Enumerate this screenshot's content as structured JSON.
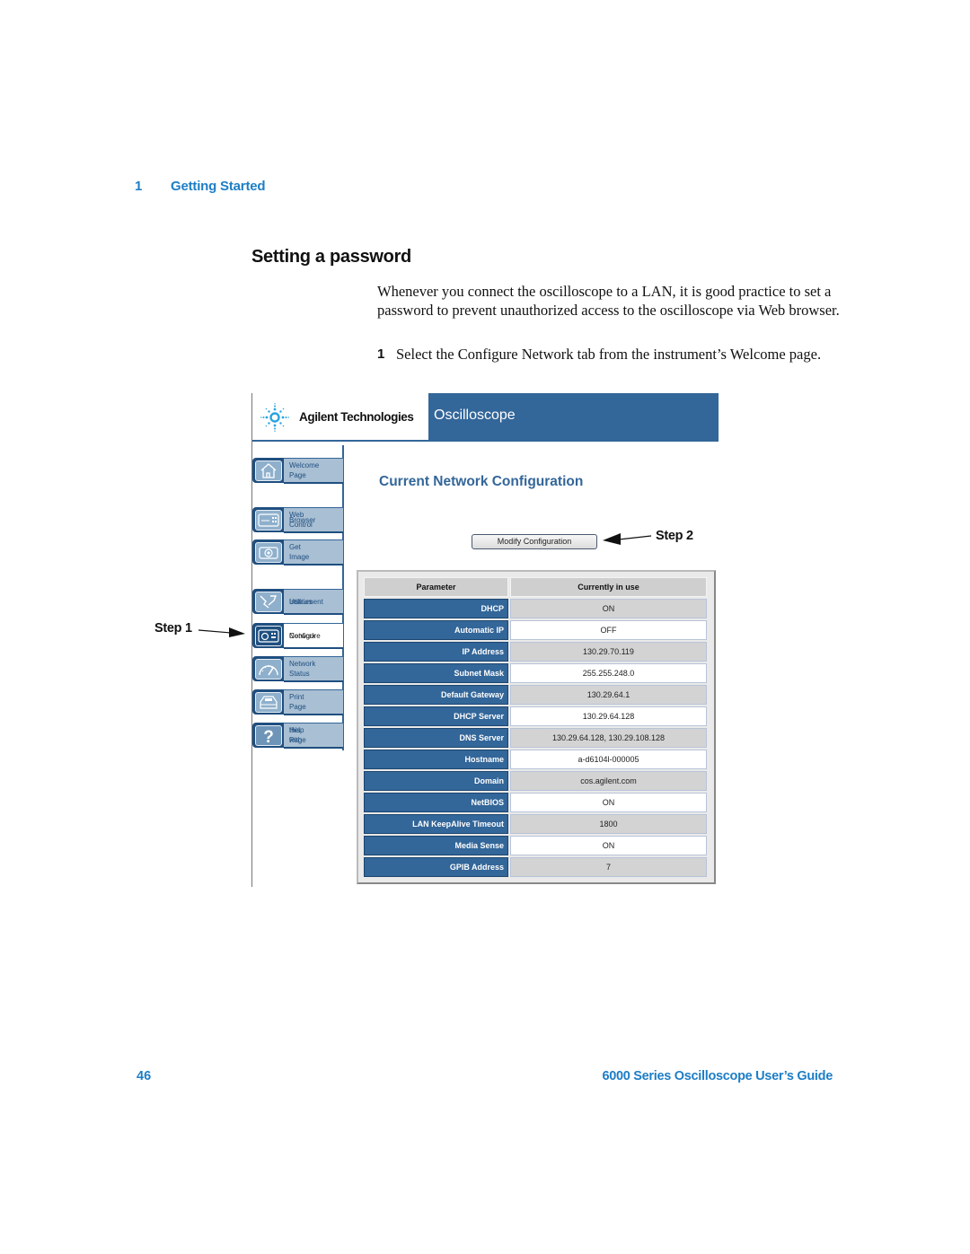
{
  "header": {
    "chapter_number": "1",
    "chapter_title": "Getting Started"
  },
  "section": {
    "title": "Setting a password",
    "intro": "Whenever you connect the oscilloscope to a LAN, it is good practice to set a password to prevent unauthorized access to the oscilloscope via Web browser.",
    "steps": [
      {
        "number": "1",
        "text": "Select the Configure Network tab from the instrument’s Welcome page."
      }
    ]
  },
  "figure": {
    "banner": {
      "brand": "Agilent Technologies",
      "product": "Oscilloscope",
      "logo_icon": "agilent-spark-icon"
    },
    "nav": [
      {
        "label_line1": "Welcome Page",
        "label_line2": "",
        "icon": "home-icon",
        "active": false
      },
      {
        "label_line1": "Browser",
        "label_line2": "Web Control",
        "icon": "browser-control-icon",
        "active": false
      },
      {
        "label_line1": "Get Image",
        "label_line2": "",
        "icon": "camera-icon",
        "active": false
      },
      {
        "label_line1": "Instrument",
        "label_line2": "Utilities",
        "icon": "tools-icon",
        "active": false
      },
      {
        "label_line1": "Configure",
        "label_line2": "Network",
        "icon": "network-config-icon",
        "active": true
      },
      {
        "label_line1": "Network Status",
        "label_line2": "",
        "icon": "gauge-icon",
        "active": false
      },
      {
        "label_line1": "Print Page",
        "label_line2": "",
        "icon": "printer-icon",
        "active": false
      },
      {
        "label_line1": "Help with",
        "label_line2": "this Page",
        "icon": "help-icon",
        "active": false
      }
    ],
    "content_title": "Current Network Configuration",
    "modify_button": "Modify Configuration",
    "table": {
      "columns": [
        "Parameter",
        "Currently in use"
      ],
      "rows": [
        [
          "DHCP",
          "ON"
        ],
        [
          "Automatic IP",
          "OFF"
        ],
        [
          "IP Address",
          "130.29.70.119"
        ],
        [
          "Subnet Mask",
          "255.255.248.0"
        ],
        [
          "Default Gateway",
          "130.29.64.1"
        ],
        [
          "DHCP Server",
          "130.29.64.128"
        ],
        [
          "DNS Server",
          "130.29.64.128, 130.29.108.128"
        ],
        [
          "Hostname",
          "a-d6104l-000005"
        ],
        [
          "Domain",
          "cos.agilent.com"
        ],
        [
          "NetBIOS",
          "ON"
        ],
        [
          "LAN KeepAlive Timeout",
          "1800"
        ],
        [
          "Media Sense",
          "ON"
        ],
        [
          "GPIB Address",
          "7"
        ]
      ]
    },
    "callouts": {
      "step1": "Step 1",
      "step2": "Step 2"
    }
  },
  "footer": {
    "page_number": "46",
    "guide_title": "6000 Series Oscilloscope User’s Guide"
  }
}
